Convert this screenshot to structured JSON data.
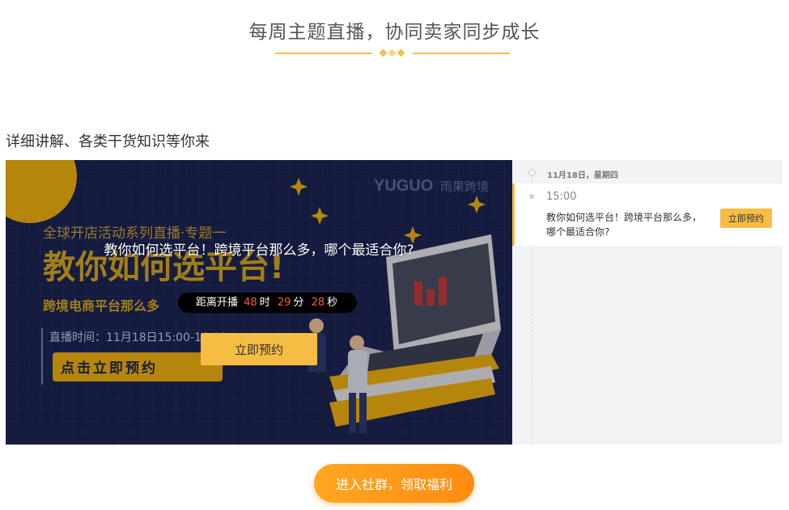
{
  "header": {
    "title": "每周主题直播，协同卖家同步成长"
  },
  "section": {
    "subtitle": "详细讲解、各类干货知识等你来"
  },
  "banner": {
    "art_text": {
      "brand_latin": "YUGUO",
      "brand_cn": "雨果跨境",
      "series": "全球开店活动系列直播·专题一",
      "big_title": "教你如何选平台!",
      "sub_line": "跨境电商平台那么多",
      "live_time": "直播时间：11月18日15:00-16:00",
      "cta": "点击立即预约"
    },
    "live_title": "教你如何选平台！跨境平台那么多，哪个最适合你?",
    "countdown": {
      "prefix": "距离开播",
      "hours": "48",
      "hours_unit": "时",
      "minutes": "29",
      "minutes_unit": "分",
      "seconds": "28",
      "seconds_unit": "秒"
    },
    "reserve_label": "立即预约"
  },
  "schedule": {
    "date": "11月18日，星期四",
    "sessions": [
      {
        "time": "15:00",
        "title": "教你如何选平台！跨境平台那么多，哪个最适合你?",
        "button": "立即预约"
      }
    ]
  },
  "footer": {
    "join_label": "进入社群，领取福利"
  },
  "colors": {
    "accent": "#f5bd43",
    "countdown_number": "#ff5a3c",
    "banner_bg": "#1c2555",
    "join_gradient_start": "#ffa722",
    "join_gradient_end": "#ff8c10"
  }
}
